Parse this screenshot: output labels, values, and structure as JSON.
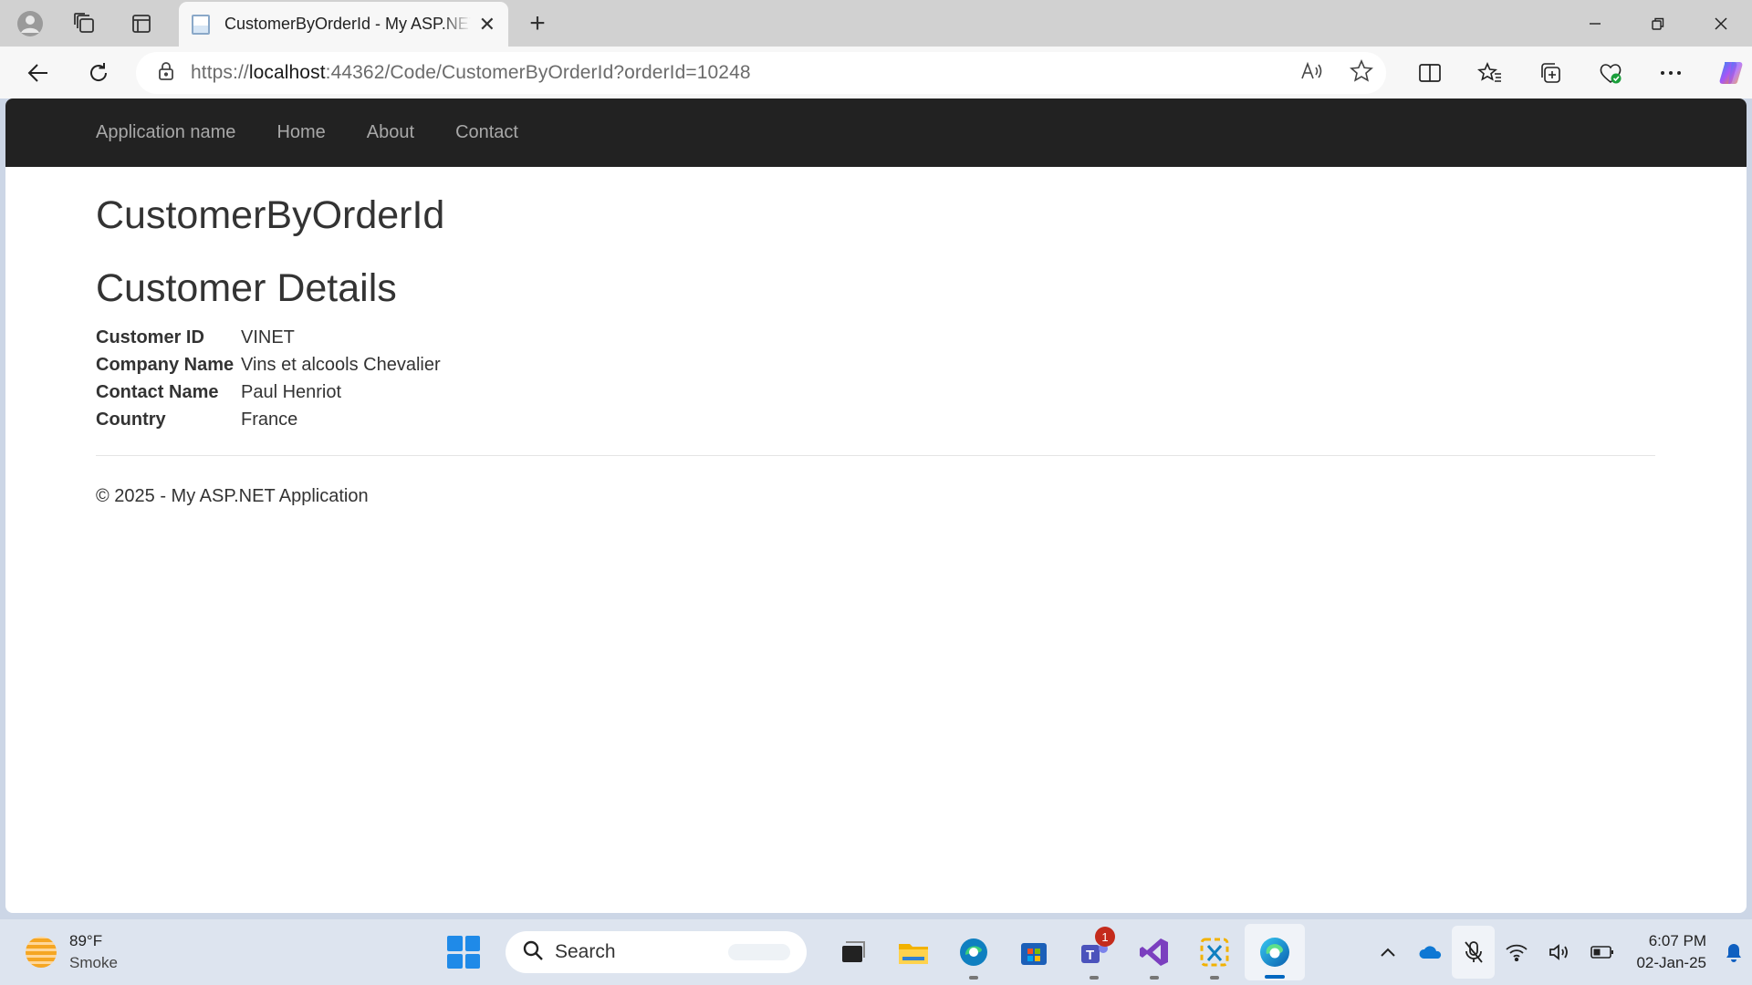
{
  "browser": {
    "tab_title": "CustomerByOrderId - My ASP.NET Application",
    "url_prefix": "https://",
    "url_host": "localhost",
    "url_rest": ":44362/Code/CustomerByOrderId?orderId=10248"
  },
  "site": {
    "brand": "Application name",
    "nav": {
      "home": "Home",
      "about": "About",
      "contact": "Contact"
    }
  },
  "page": {
    "title": "CustomerByOrderId",
    "section_title": "Customer Details",
    "details": [
      {
        "label": "Customer ID",
        "value": "VINET"
      },
      {
        "label": "Company Name",
        "value": "Vins et alcools Chevalier"
      },
      {
        "label": "Contact Name",
        "value": "Paul Henriot"
      },
      {
        "label": "Country",
        "value": "France"
      }
    ],
    "footer": "© 2025 - My ASP.NET Application"
  },
  "taskbar": {
    "weather_temp": "89°F",
    "weather_cond": "Smoke",
    "search_label": "Search",
    "teams_badge": "1",
    "time": "6:07 PM",
    "date": "02-Jan-25"
  },
  "colors": {
    "navbar_bg": "#222222",
    "accent": "#0067c0",
    "badge": "#c42b1c"
  }
}
